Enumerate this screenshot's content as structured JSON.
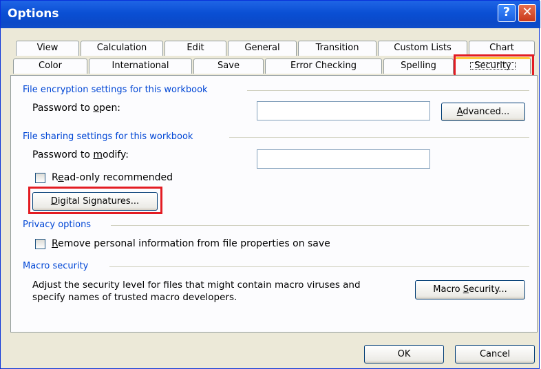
{
  "window": {
    "title": "Options",
    "help_glyph": "?",
    "close_glyph": "✕"
  },
  "tabs_row1": [
    "View",
    "Calculation",
    "Edit",
    "General",
    "Transition",
    "Custom Lists",
    "Chart"
  ],
  "tabs_row2": [
    "Color",
    "International",
    "Save",
    "Error Checking",
    "Spelling",
    "Security"
  ],
  "active_tab": "Security",
  "encryption": {
    "group_label": "File encryption settings for this workbook",
    "password_open_label": "Password to open:",
    "password_open_value": "",
    "advanced_button": "Advanced..."
  },
  "sharing": {
    "group_label": "File sharing settings for this workbook",
    "password_modify_label": "Password to modify:",
    "password_modify_value": "",
    "readonly_label": "Read-only recommended",
    "readonly_checked": false,
    "digital_signatures_button": "Digital Signatures..."
  },
  "privacy": {
    "group_label": "Privacy options",
    "remove_info_label": "Remove personal information from file properties on save",
    "remove_info_checked": false
  },
  "macro": {
    "group_label": "Macro security",
    "description_line1": "Adjust the security level for files that might contain macro viruses and",
    "description_line2": "specify names of trusted macro developers.",
    "macro_security_button": "Macro Security..."
  },
  "footer": {
    "ok_button": "OK",
    "cancel_button": "Cancel"
  },
  "colors": {
    "highlight": "#e31c23",
    "title_bar": "#0b49c8",
    "group_text": "#0046d5"
  }
}
